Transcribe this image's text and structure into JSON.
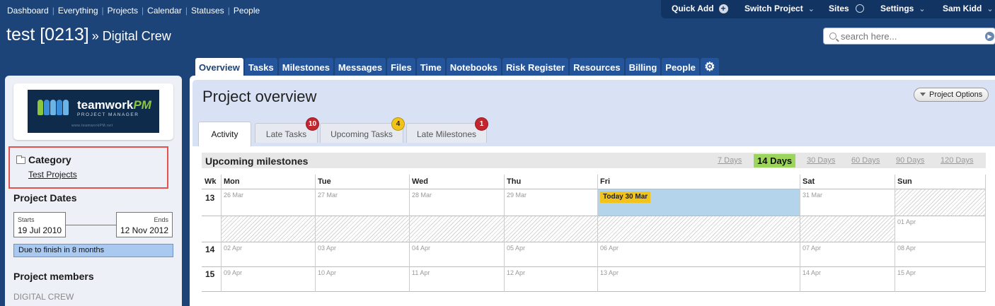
{
  "topnav": {
    "items": [
      "Dashboard",
      "Everything",
      "Projects",
      "Calendar",
      "Statuses",
      "People"
    ]
  },
  "rightbar": {
    "quick_add": "Quick Add",
    "switch_project": "Switch Project",
    "sites": "Sites",
    "settings": "Settings",
    "user": "Sam Kidd"
  },
  "header": {
    "title": "test [0213]",
    "company": "» Digital Crew"
  },
  "search": {
    "placeholder": "search here..."
  },
  "tabs": [
    "Overview",
    "Tasks",
    "Milestones",
    "Messages",
    "Files",
    "Time",
    "Notebooks",
    "Risk Register",
    "Resources",
    "Billing",
    "People"
  ],
  "sidebar": {
    "logo": {
      "brand_a": "teamwork",
      "brand_b": "PM",
      "tagline": "PROJECT MANAGER",
      "url": "www.teamworkPM.net"
    },
    "category_label": "Category",
    "category_value": "Test Projects",
    "dates_title": "Project Dates",
    "starts_label": "Starts",
    "starts_value": "19 Jul 2010",
    "ends_label": "Ends",
    "ends_value": "12 Nov 2012",
    "due_text": "Due to finish in 8 months",
    "progress_fraction": 1.0,
    "members_title": "Project members",
    "crew": "DIGITAL CREW"
  },
  "overview": {
    "title": "Project overview",
    "options_button": "Project Options",
    "subtabs": [
      {
        "label": "Activity",
        "badge": ""
      },
      {
        "label": "Late Tasks",
        "badge": "10"
      },
      {
        "label": "Upcoming Tasks",
        "badge": "4"
      },
      {
        "label": "Late Milestones",
        "badge": "1"
      }
    ]
  },
  "milestones": {
    "title": "Upcoming milestones",
    "ranges": [
      "7 Days",
      "14 Days",
      "30 Days",
      "60 Days",
      "90 Days",
      "120 Days"
    ],
    "selected_range": "14 Days"
  },
  "calendar": {
    "week_label": "Wk",
    "days": [
      "Mon",
      "Tue",
      "Wed",
      "Thu",
      "Fri",
      "Sat",
      "Sun"
    ],
    "weeks": [
      {
        "wk": "13",
        "dates": [
          "26 Mar",
          "27 Mar",
          "28 Mar",
          "29 Mar",
          "",
          "31 Mar",
          ""
        ]
      },
      {
        "wk": "",
        "dates": [
          "",
          "",
          "",
          "",
          "",
          "",
          "01 Apr"
        ]
      },
      {
        "wk": "14",
        "dates": [
          "02 Apr",
          "03 Apr",
          "04 Apr",
          "05 Apr",
          "06 Apr",
          "07 Apr",
          "08 Apr"
        ]
      },
      {
        "wk": "15",
        "dates": [
          "09 Apr",
          "10 Apr",
          "11 Apr",
          "12 Apr",
          "13 Apr",
          "14 Apr",
          "15 Apr"
        ]
      }
    ],
    "today_label": "Today 30 Mar"
  },
  "colors": {
    "header_bg": "#1d4478",
    "today_highlight": "#b4d4ec",
    "today_tag": "#f2c31b",
    "selected_range": "#9dd45c",
    "badge_red": "#c4262e",
    "badge_yellow": "#f2c31b"
  }
}
